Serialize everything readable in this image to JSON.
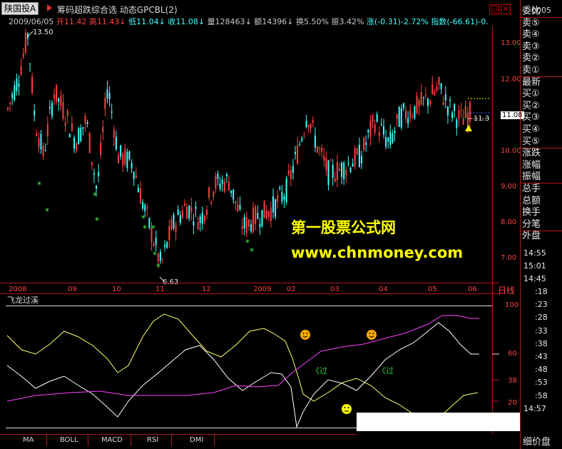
{
  "header": {
    "stock_name": "陕国投A",
    "formula_name": "筹码超跌综合选 动态GPCBL(2)",
    "code": "0005",
    "close_btn": "×",
    "restore_btn": "□"
  },
  "quote": {
    "date": "2009/06/05",
    "open_label": "开11.42",
    "high_label": "高11.43",
    "low_label": "低11.04",
    "close_label": "收11.08",
    "vol_label": "量128463",
    "amount_label": "额14396",
    "turnover_label": "换5.50%",
    "amplitude_label": "振3.42%",
    "change_label": "涨(-0.31)-2.72%",
    "index_label": "指数(-66.61)-0."
  },
  "chart": {
    "high_marker": "13.50",
    "low_marker": "6.63",
    "last_price": "11.08",
    "last_tag": "11.3",
    "y_labels": [
      "13.00",
      "12.00",
      "11.00",
      "10.00",
      "9.00",
      "8.00",
      "7.00"
    ],
    "x_labels": [
      "2008",
      "09",
      "10",
      "11",
      "12",
      "2009",
      "02",
      "03",
      "04",
      "05",
      "06"
    ],
    "x_unit": "日线"
  },
  "indicator": {
    "title": "飞龙过溪",
    "y_labels": [
      "100",
      "60",
      "38",
      "20"
    ],
    "text1": "《过",
    "text2": "《过"
  },
  "watermark": {
    "line1": "第一股票公式网",
    "line2": "www.chnmoney.com"
  },
  "tabs": [
    "MA",
    "BOLL",
    "MACD",
    "RSI",
    "DMI"
  ],
  "side": {
    "items": [
      "委比",
      "卖⑤",
      "卖④",
      "卖③",
      "卖②",
      "卖①",
      "最新",
      "买①",
      "买②",
      "买③",
      "买④",
      "买⑤",
      "涨跌",
      "涨幅",
      "振幅",
      "总手",
      "总额",
      "换手",
      "分笔",
      "外盘"
    ],
    "times": [
      "14:55",
      "15:01",
      "14:45",
      ":18",
      ":23",
      ":28",
      ":33",
      ":38",
      ":43",
      ":48",
      ":53",
      ":58",
      "14:57"
    ],
    "bottom": "细价盘"
  },
  "colors": {
    "up": "#ff4040",
    "down": "#40ffff",
    "grid": "#b01818",
    "accent_yellow": "#ffff00",
    "ind_yellow": "#ffff66",
    "ind_white": "#ffffff",
    "ind_magenta": "#ff40ff"
  }
}
